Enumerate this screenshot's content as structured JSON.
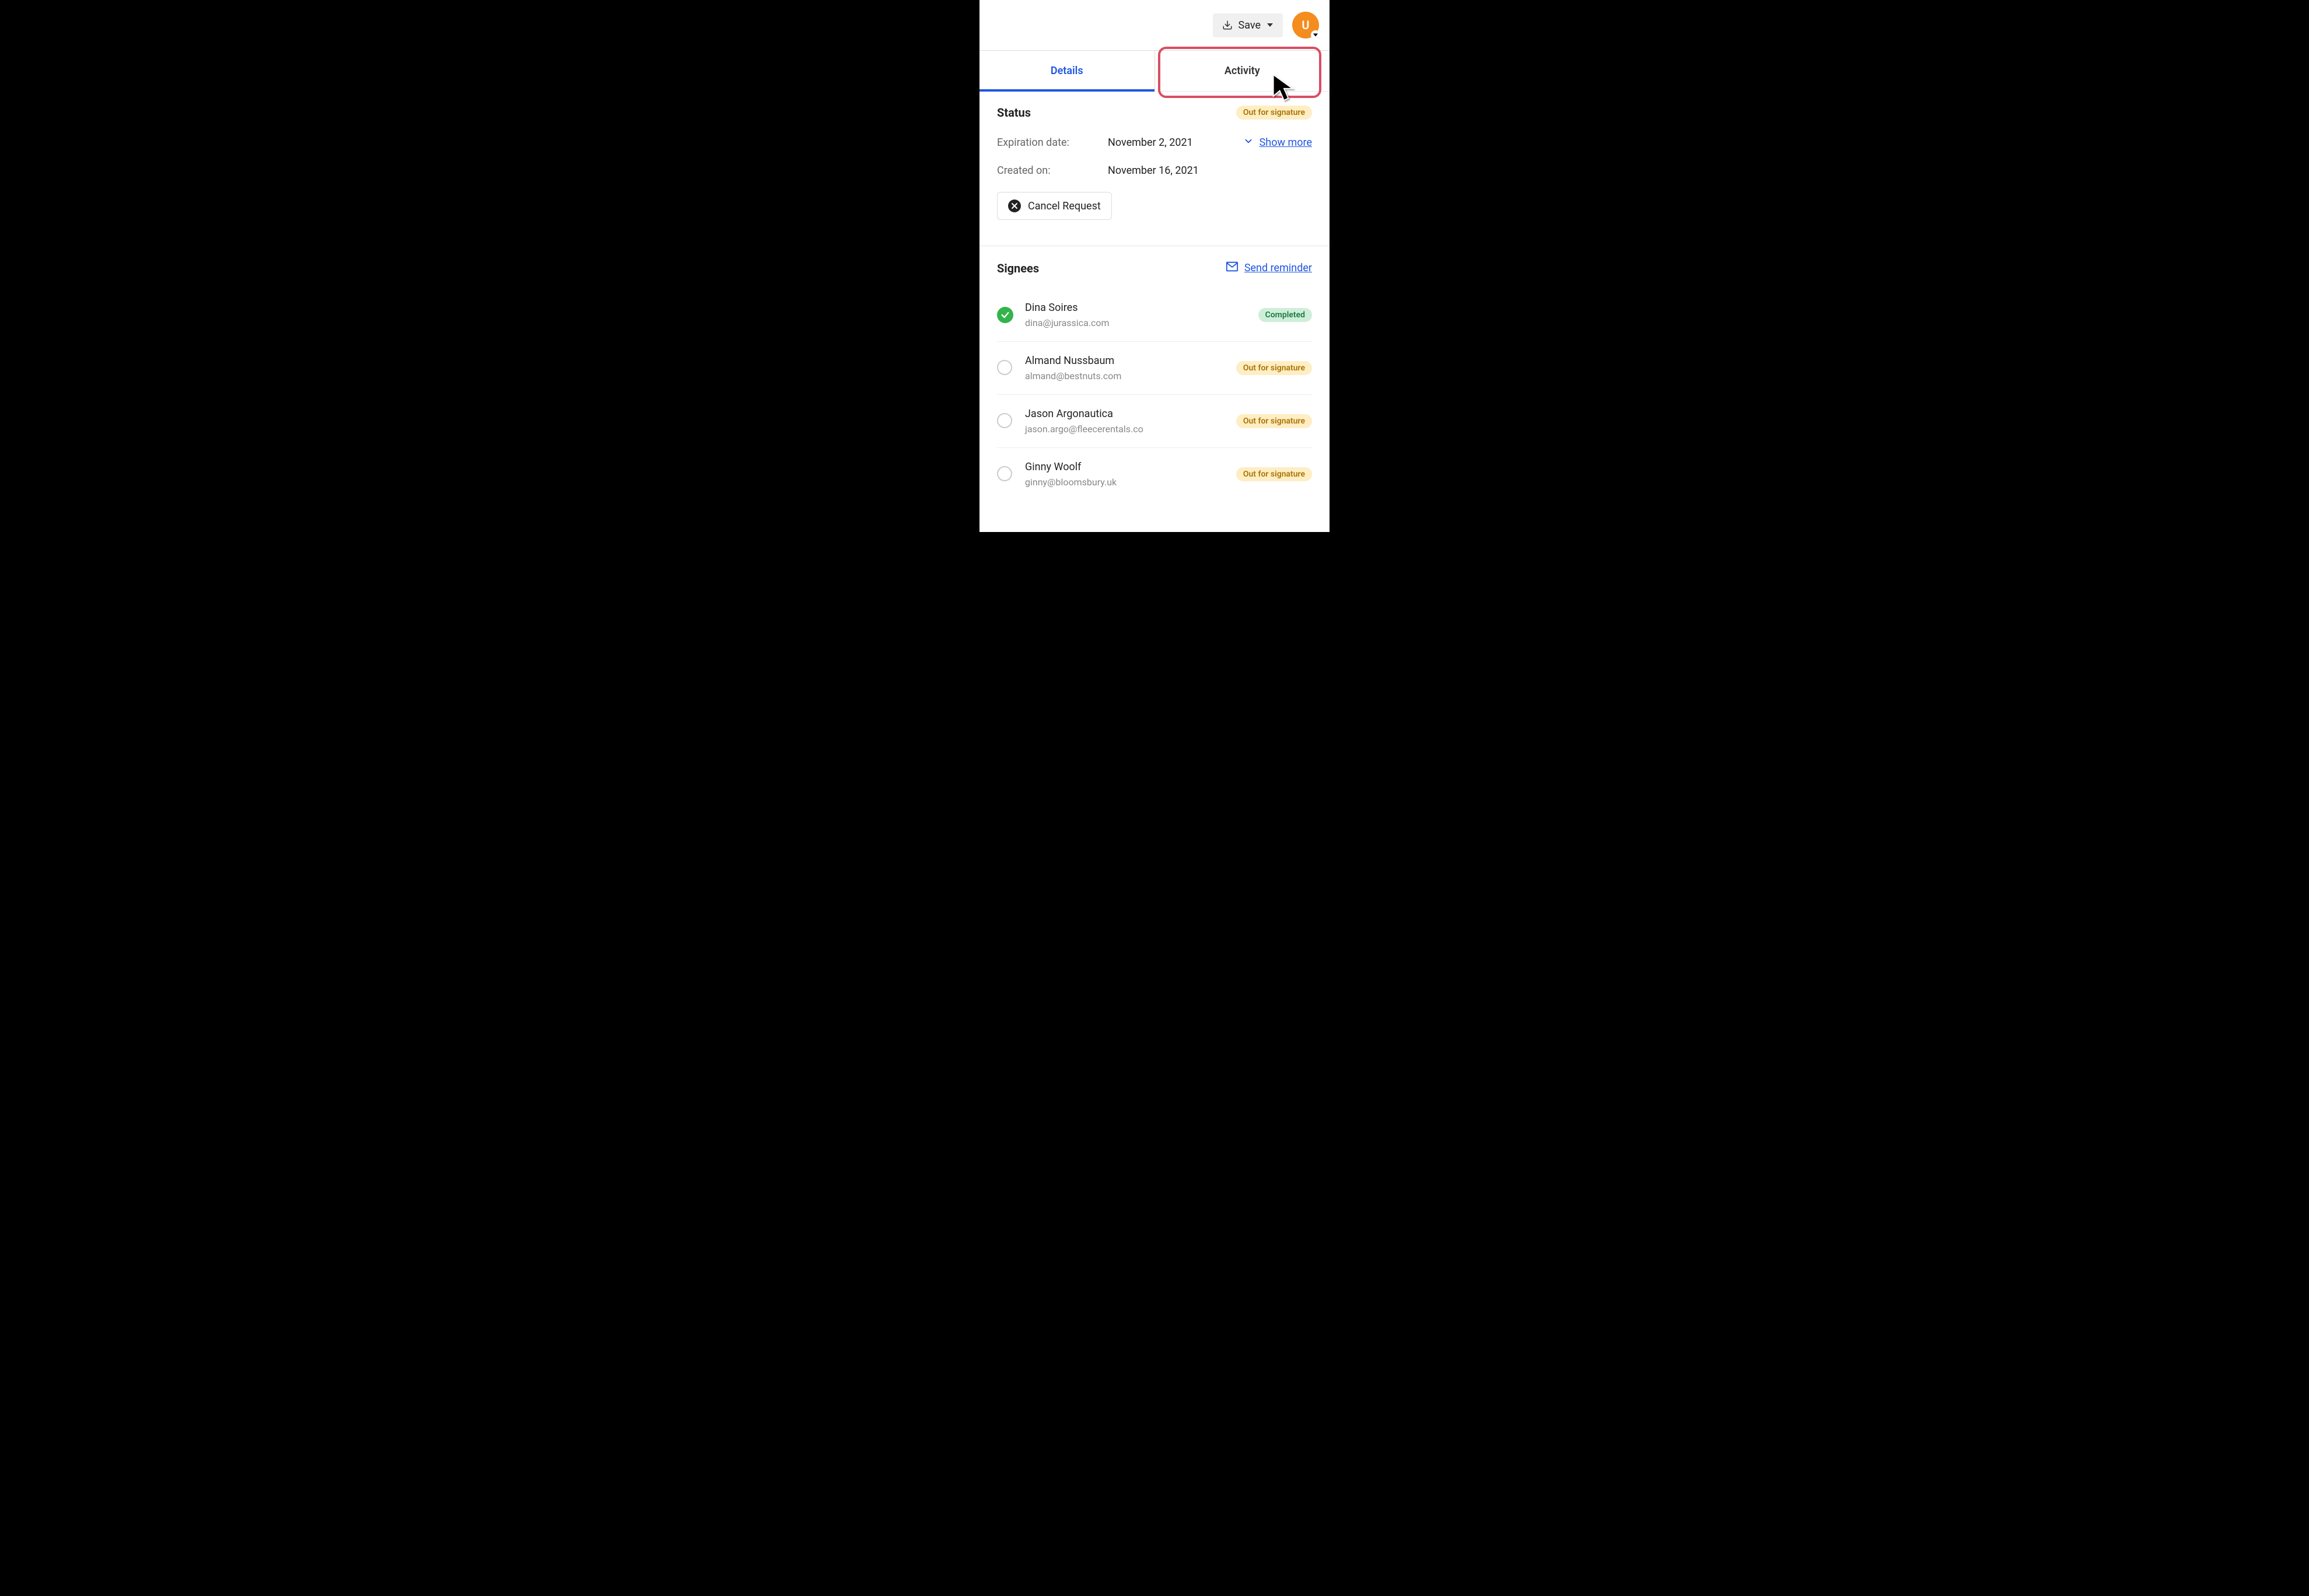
{
  "header": {
    "save_label": "Save",
    "avatar_initial": "U"
  },
  "tabs": {
    "details_label": "Details",
    "activity_label": "Activity"
  },
  "status": {
    "title": "Status",
    "badge": "Out for signature",
    "expiration_key": "Expiration date:",
    "expiration_val": "November 2, 2021",
    "created_key": "Created on:",
    "created_val": "November 16, 2021",
    "show_more_label": "Show more",
    "cancel_label": "Cancel Request"
  },
  "signees": {
    "title": "Signees",
    "send_reminder_label": "Send reminder",
    "list": [
      {
        "name": "Dina Soires",
        "email": "dina@jurassica.com",
        "status": "completed",
        "badge": "Completed"
      },
      {
        "name": "Almand Nussbaum",
        "email": "almand@bestnuts.com",
        "status": "pending",
        "badge": "Out for signature"
      },
      {
        "name": "Jason Argonautica",
        "email": "jason.argo@fleecerentals.co",
        "status": "pending",
        "badge": "Out for signature"
      },
      {
        "name": "Ginny Woolf",
        "email": "ginny@bloomsbury.uk",
        "status": "pending",
        "badge": "Out for signature"
      }
    ]
  }
}
